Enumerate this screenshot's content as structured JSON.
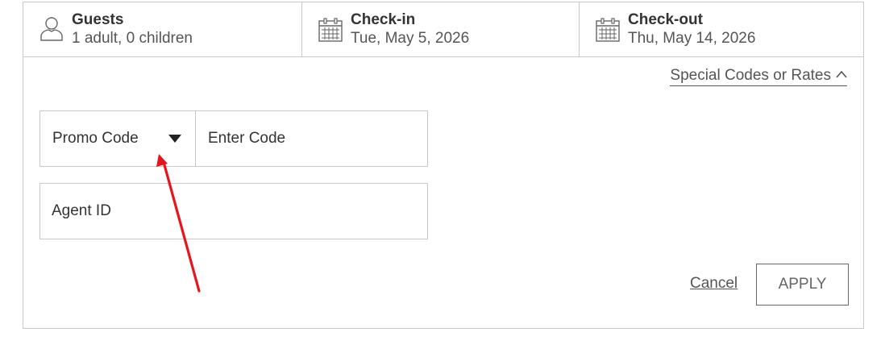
{
  "header": {
    "guests": {
      "title": "Guests",
      "value": "1 adult, 0 children",
      "icon": "person-icon"
    },
    "check_in": {
      "title": "Check-in",
      "value": "Tue, May 5, 2026",
      "icon": "calendar-icon"
    },
    "check_out": {
      "title": "Check-out",
      "value": "Thu, May 14, 2026",
      "icon": "calendar-icon"
    }
  },
  "special_codes": {
    "label": "Special Codes or Rates",
    "icon": "chevron-up-icon"
  },
  "form": {
    "code_type": {
      "selected": "Promo Code",
      "icon": "caret-down-icon"
    },
    "code_input": {
      "placeholder": "Enter Code",
      "value": ""
    },
    "agent_input": {
      "placeholder": "Agent ID",
      "value": ""
    }
  },
  "actions": {
    "cancel_label": "Cancel",
    "apply_label": "APPLY"
  },
  "annotation": {
    "type": "red-arrow",
    "color": "#e8141c",
    "points_to": "promo-code-dropdown"
  },
  "colors": {
    "border": "#c8c8c8",
    "text": "#333333",
    "muted": "#555555"
  }
}
